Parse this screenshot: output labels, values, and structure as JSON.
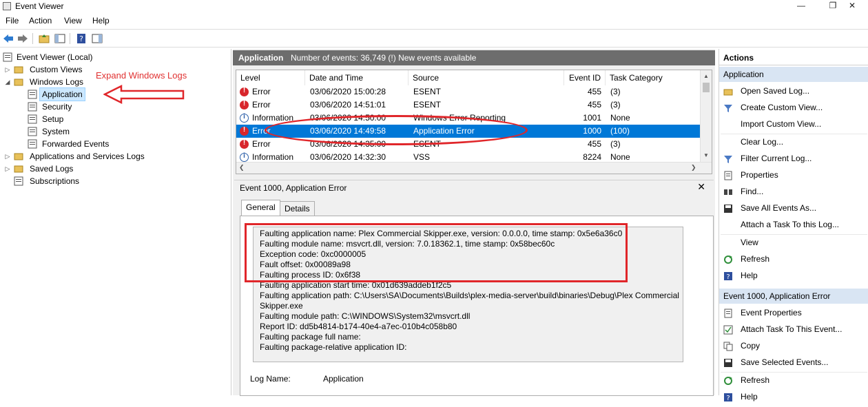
{
  "window": {
    "title": "Event Viewer",
    "controls": [
      "—",
      "❐",
      "✕"
    ]
  },
  "menu": [
    "File",
    "Action",
    "View",
    "Help"
  ],
  "tree": {
    "root": "Event Viewer (Local)",
    "custom_views": "Custom Views",
    "windows_logs": "Windows Logs",
    "logs": [
      "Application",
      "Security",
      "Setup",
      "System",
      "Forwarded Events"
    ],
    "app_services": "Applications and Services Logs",
    "saved_logs": "Saved Logs",
    "subscriptions": "Subscriptions"
  },
  "annotation": {
    "text": "Expand Windows Logs",
    "color": "#e03030"
  },
  "list": {
    "header_title": "Application",
    "header_info": "Number of events: 36,749 (!) New events available",
    "columns": [
      "Level",
      "Date and Time",
      "Source",
      "Event ID",
      "Task Category"
    ],
    "rows": [
      {
        "level": "Error",
        "icon": "error-icon",
        "date": "03/06/2020 15:00:28",
        "source": "ESENT",
        "event_id": "455",
        "task": "(3)"
      },
      {
        "level": "Error",
        "icon": "error-icon",
        "date": "03/06/2020 14:51:01",
        "source": "ESENT",
        "event_id": "455",
        "task": "(3)"
      },
      {
        "level": "Information",
        "icon": "info-icon",
        "date": "03/06/2020 14:50:00",
        "source": "Windows Error Reporting",
        "event_id": "1001",
        "task": "None"
      },
      {
        "level": "Error",
        "icon": "error-icon",
        "date": "03/06/2020 14:49:58",
        "source": "Application Error",
        "event_id": "1000",
        "task": "(100)"
      },
      {
        "level": "Error",
        "icon": "error-icon",
        "date": "03/06/2020 14:35:00",
        "source": "ESENT",
        "event_id": "455",
        "task": "(3)"
      },
      {
        "level": "Information",
        "icon": "info-icon",
        "date": "03/06/2020 14:32:30",
        "source": "VSS",
        "event_id": "8224",
        "task": "None"
      }
    ]
  },
  "details": {
    "title": "Event 1000, Application Error",
    "close": "✕",
    "tabs": [
      "General",
      "Details"
    ],
    "lines": [
      "Faulting application name: Plex Commercial Skipper.exe, version: 0.0.0.0, time stamp: 0x5e6a36c0",
      "Faulting module name: msvcrt.dll, version: 7.0.18362.1, time stamp: 0x58bec60c",
      "Exception code: 0xc0000005",
      "Fault offset: 0x00089a98",
      "Faulting process ID: 0x6f38",
      "Faulting application start time: 0x01d639addeb1f2c5",
      "Faulting application path: C:\\Users\\SA\\Documents\\Builds\\plex-media-server\\build\\binaries\\Debug\\Plex Commercial",
      "Skipper.exe",
      "Faulting module path: C:\\WINDOWS\\System32\\msvcrt.dll",
      "Report ID: dd5b4814-b174-40e4-a7ec-010b4c058b80",
      "Faulting package full name:",
      "Faulting package-relative application ID:"
    ],
    "log_name_label": "Log Name:",
    "log_name_value": "Application"
  },
  "actions": {
    "title": "Actions",
    "section1": "Application",
    "items1": [
      {
        "label": "Open Saved Log...",
        "icon": "folder-open-icon"
      },
      {
        "label": "Create Custom View...",
        "icon": "filter-icon"
      },
      {
        "label": "Import Custom View...",
        "icon": "blank-icon"
      },
      {
        "label": "Clear Log...",
        "icon": "blank-icon"
      },
      {
        "label": "Filter Current Log...",
        "icon": "filter-icon"
      },
      {
        "label": "Properties",
        "icon": "properties-icon"
      },
      {
        "label": "Find...",
        "icon": "find-icon"
      },
      {
        "label": "Save All Events As...",
        "icon": "save-icon"
      },
      {
        "label": "Attach a Task To this Log...",
        "icon": "blank-icon"
      },
      {
        "label": "View",
        "icon": "blank-icon"
      },
      {
        "label": "Refresh",
        "icon": "refresh-icon"
      },
      {
        "label": "Help",
        "icon": "help-icon"
      }
    ],
    "section2": "Event 1000, Application Error",
    "items2": [
      {
        "label": "Event Properties",
        "icon": "properties-icon"
      },
      {
        "label": "Attach Task To This Event...",
        "icon": "task-icon"
      },
      {
        "label": "Copy",
        "icon": "copy-icon"
      },
      {
        "label": "Save Selected Events...",
        "icon": "save-icon"
      },
      {
        "label": "Refresh",
        "icon": "refresh-icon"
      },
      {
        "label": "Help",
        "icon": "help-icon"
      }
    ]
  },
  "colors": {
    "selection": "#0078d7",
    "error": "#d8262c",
    "annotation_red": "#e0262a",
    "header_grey": "#6d6d6d"
  }
}
